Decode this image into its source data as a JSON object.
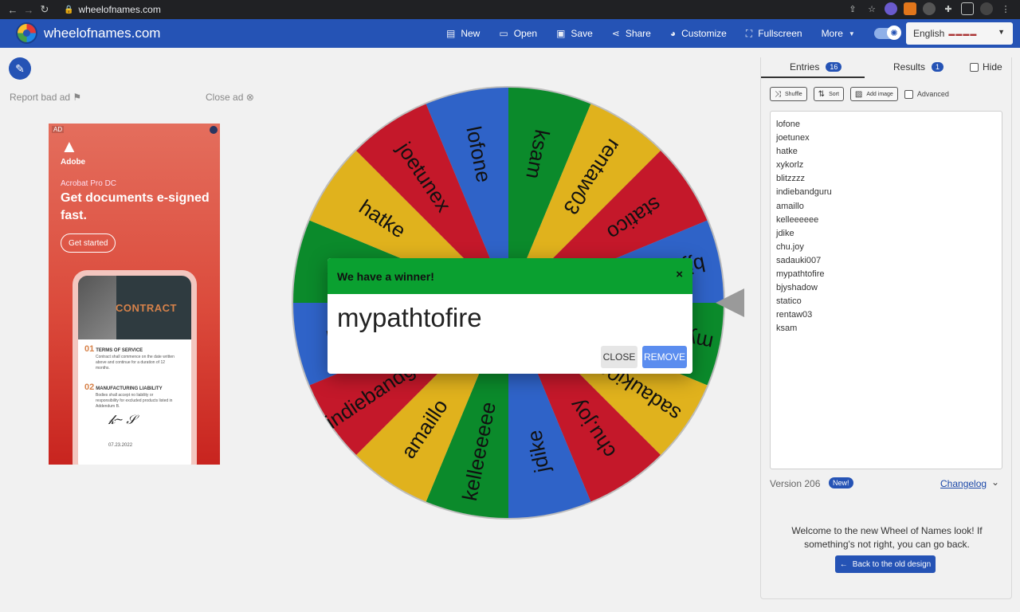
{
  "browser": {
    "url": "wheelofnames.com"
  },
  "header": {
    "brand": "wheelofnames.com",
    "menu": [
      {
        "label": "New",
        "icon": "file-icon"
      },
      {
        "label": "Open",
        "icon": "folder-icon"
      },
      {
        "label": "Save",
        "icon": "floppy-icon"
      },
      {
        "label": "Share",
        "icon": "share-icon"
      },
      {
        "label": "Customize",
        "icon": "palette-icon"
      },
      {
        "label": "Fullscreen",
        "icon": "fullscreen-icon"
      },
      {
        "label": "More",
        "icon": "caret-down-icon"
      }
    ],
    "language": "English"
  },
  "left": {
    "report_ad": "Report bad ad",
    "close_ad": "Close ad",
    "ad": {
      "tag": "AD",
      "brand": "Adobe",
      "product": "Acrobat Pro DC",
      "headline": "Get documents e-signed fast.",
      "cta": "Get started",
      "doc_title": "CONTRACT",
      "section1_num": "01",
      "section1": "TERMS OF SERVICE",
      "section1_body": "Contract shall commence on the date written above and continue for a duration of 12 months.",
      "section2_num": "02",
      "section2": "MANUFACTURING LIABILITY",
      "section2_body": "Bodies shall accept no liability or responsibility for excluded products listed in Addendum B.",
      "date": "07.23.2022"
    }
  },
  "wheel": {
    "colors": {
      "green": "#0b8a2b",
      "yellow": "#e0b21d",
      "red": "#c4182a",
      "blue": "#2f63c8"
    },
    "segments": [
      {
        "label": "ksam",
        "color": "green"
      },
      {
        "label": "rentaw03",
        "color": "yellow"
      },
      {
        "label": "statico",
        "color": "red"
      },
      {
        "label": "bjyshadow",
        "color": "blue"
      },
      {
        "label": "mypathtofire",
        "color": "green"
      },
      {
        "label": "sadauki007",
        "color": "yellow"
      },
      {
        "label": "chu.joy",
        "color": "red"
      },
      {
        "label": "jdike",
        "color": "blue"
      },
      {
        "label": "kelleeeeee",
        "color": "green"
      },
      {
        "label": "amaillo",
        "color": "yellow"
      },
      {
        "label": "indiebandguru",
        "color": "red"
      },
      {
        "label": "blitzzzz",
        "color": "blue"
      },
      {
        "label": "xykorlz",
        "color": "green"
      },
      {
        "label": "hatke",
        "color": "yellow"
      },
      {
        "label": "joetunex",
        "color": "red"
      },
      {
        "label": "lofone",
        "color": "blue"
      }
    ]
  },
  "modal": {
    "title": "We have a winner!",
    "close_x": "×",
    "winner": "mypathtofire",
    "close_label": "CLOSE",
    "remove_label": "REMOVE"
  },
  "panel": {
    "tab_entries": "Entries",
    "entries_count": "16",
    "tab_results": "Results",
    "results_count": "1",
    "hide_label": "Hide",
    "shuffle": "Shuffle",
    "sort": "Sort",
    "add_image": "Add image",
    "advanced": "Advanced",
    "entries": [
      "lofone",
      "joetunex",
      "hatke",
      "xykorlz",
      "blitzzzz",
      "indiebandguru",
      "amaillo",
      "kelleeeeee",
      "jdike",
      "chu.joy",
      "sadauki007",
      "mypathtofire",
      "bjyshadow",
      "statico",
      "rentaw03",
      "ksam"
    ],
    "version": "Version 206",
    "new_badge": "New!",
    "changelog": "Changelog",
    "welcome": "Welcome to the new Wheel of Names look! If something's not right, you can go back.",
    "back_button": "Back to the old design"
  }
}
